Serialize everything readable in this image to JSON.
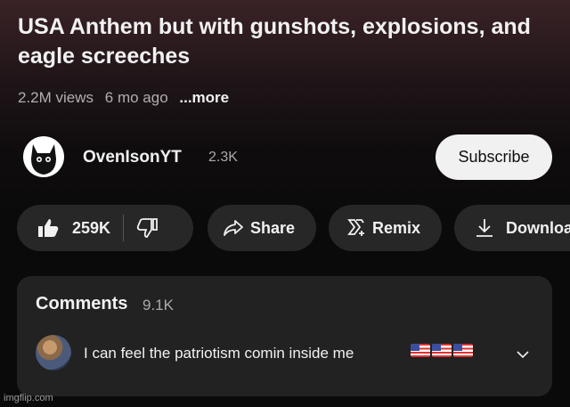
{
  "video": {
    "title": "USA Anthem but with gunshots, explosions, and eagle screeches",
    "views": "2.2M views",
    "age": "6 mo ago",
    "more_label": "...more"
  },
  "channel": {
    "name": "OvenIsonYT",
    "subscribers": "2.3K",
    "subscribe_label": "Subscribe"
  },
  "actions": {
    "likes": "259K",
    "share_label": "Share",
    "remix_label": "Remix",
    "download_label": "Downloa"
  },
  "comments": {
    "title": "Comments",
    "count": "9.1K",
    "top_comment": {
      "text": "I can feel the patriotism comin inside me",
      "flags": "🇺🇸🇺🇸🇺🇸"
    }
  },
  "watermark": "imgflip.com",
  "colors": {
    "background": "#0f0f0f",
    "pill": "#272727",
    "panel": "#222222",
    "subscribe_bg": "#f1f1f1"
  }
}
